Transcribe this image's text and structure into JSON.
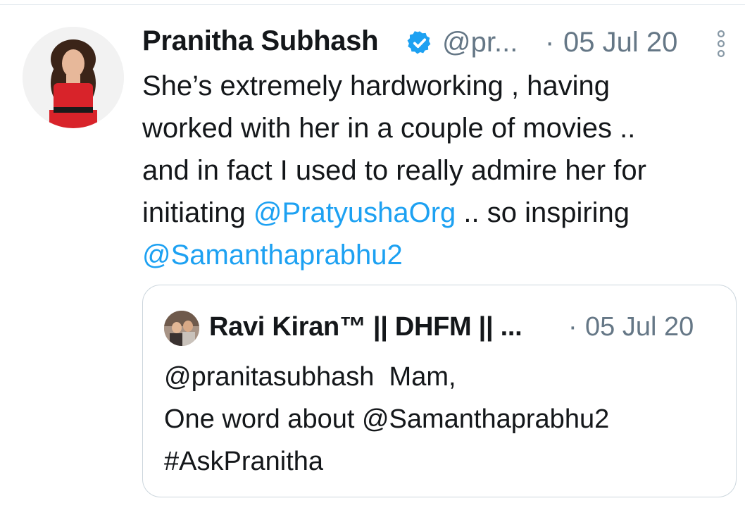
{
  "tweet": {
    "author_name": "Pranitha Subhash",
    "handle": "@pr...",
    "separator": "·",
    "timestamp": "05 Jul 20",
    "text_lines": [
      [
        {
          "t": "She’s extremely hardworking , having"
        }
      ],
      [
        {
          "t": "worked with her in a couple of movies .."
        }
      ],
      [
        {
          "t": "and in fact I used to really admire her for"
        }
      ]
    ],
    "line4_prefix": "initiating ",
    "line4_mention": "@PratyushaOrg",
    "line4_suffix": " .. so inspiring",
    "line5_mention": "@Samanthaprabhu2",
    "icons": {
      "verified": "verified-badge-icon",
      "more": "more-options-icon"
    }
  },
  "quoted_tweet": {
    "author_name": "Ravi Kiran™ || DHFM || ...",
    "separator": "·",
    "timestamp": "05 Jul 20",
    "line1": "@pranitasubhash  Mam,",
    "line2": "One word about @Samanthaprabhu2",
    "line3": "#AskPranitha"
  },
  "colors": {
    "link": "#1da1f2",
    "secondary_text": "#657786",
    "primary_text": "#14171a",
    "border": "#ccd6dd"
  }
}
